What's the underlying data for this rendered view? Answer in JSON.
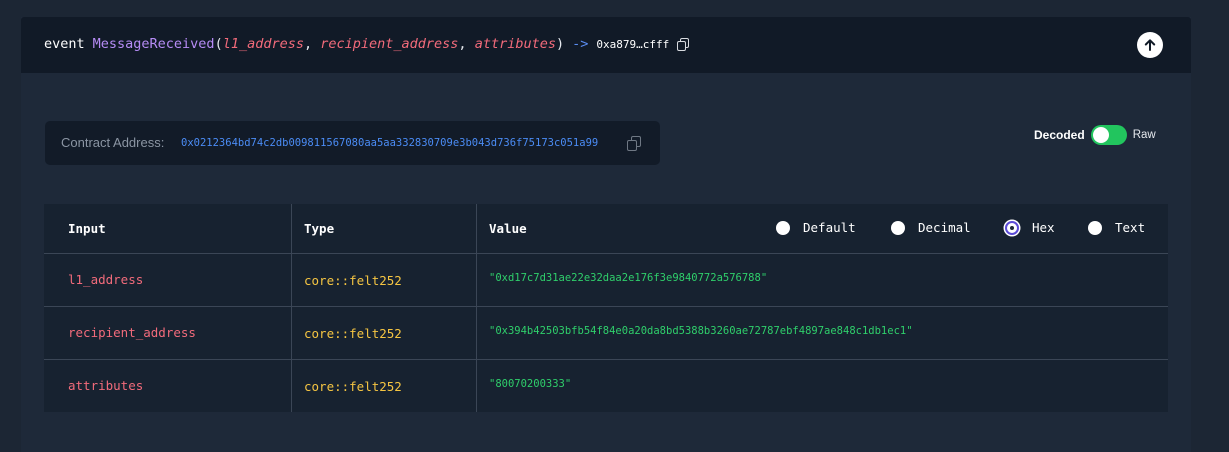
{
  "event": {
    "keyword": "event",
    "name": "MessageReceived",
    "params": [
      "l1_address",
      "recipient_address",
      "attributes"
    ],
    "arrow": "->",
    "address_short": "0xa879…cfff"
  },
  "contract": {
    "label": "Contract Address:",
    "address": "0x0212364bd74c2db009811567080aa5aa332830709e3b043d736f75173c051a99"
  },
  "toggle": {
    "left_label": "Decoded",
    "right_label": "Raw",
    "state": "Decoded"
  },
  "table": {
    "headers": {
      "input": "Input",
      "type": "Type",
      "value": "Value"
    },
    "format_options": [
      "Default",
      "Decimal",
      "Hex",
      "Text"
    ],
    "selected_format": "Hex",
    "rows": [
      {
        "input": "l1_address",
        "type": "core::felt252",
        "value": "\"0xd17c7d31ae22e32daa2e176f3e9840772a576788\""
      },
      {
        "input": "recipient_address",
        "type": "core::felt252",
        "value": "\"0x394b42503bfb54f84e0a20da8bd5388b3260ae72787ebf4897ae848c1db1ec1\""
      },
      {
        "input": "attributes",
        "type": "core::felt252",
        "value": "\"80070200333\""
      }
    ]
  },
  "colors": {
    "accent_purple": "#b68cf5",
    "param_red": "#f26b7b",
    "type_yellow": "#f5c542",
    "value_green": "#2fcf6b",
    "link_blue": "#4b8cf5",
    "toggle_green": "#22c55e"
  },
  "icons": {
    "copy": "copy-icon",
    "collapse": "arrow-up-icon"
  }
}
